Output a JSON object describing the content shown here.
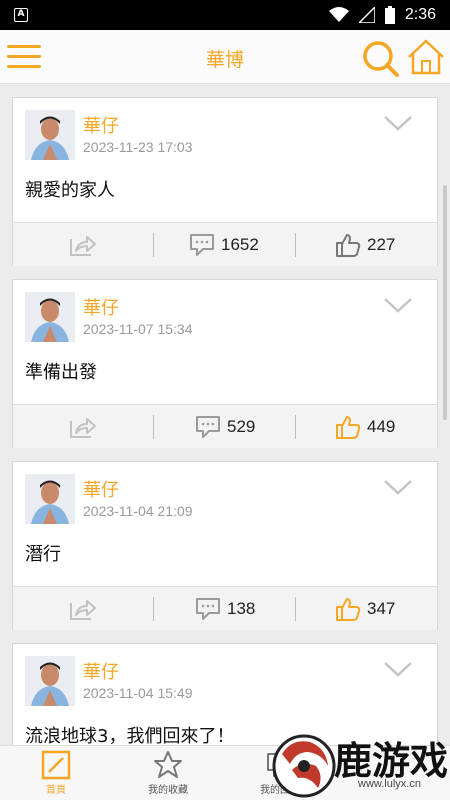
{
  "status_bar": {
    "time": "2:36",
    "app_icon_letter": "A"
  },
  "header": {
    "title": "華博"
  },
  "posts": [
    {
      "author": "華仔",
      "date": "2023-11-23 17:03",
      "content": "親愛的家人",
      "comments": "1652",
      "likes": "227",
      "liked": false
    },
    {
      "author": "華仔",
      "date": "2023-11-07 15:34",
      "content": "準備出發",
      "comments": "529",
      "likes": "449",
      "liked": true
    },
    {
      "author": "華仔",
      "date": "2023-11-04 21:09",
      "content": "潛行",
      "comments": "138",
      "likes": "347",
      "liked": true
    },
    {
      "author": "華仔",
      "date": "2023-11-04 15:49",
      "content": "流浪地球3，我們回來了！",
      "comments": "",
      "likes": "",
      "liked": false
    }
  ],
  "tabs": [
    {
      "label": "首頁",
      "icon": "pencil-icon",
      "active": true
    },
    {
      "label": "我的收藏",
      "icon": "star-icon",
      "active": false
    },
    {
      "label": "我的回應",
      "icon": "reply-icon",
      "active": false
    },
    {
      "label": "",
      "icon": "more-icon",
      "active": false
    }
  ],
  "watermark": {
    "text": "鹿游戏",
    "url": "www.lulyx.cn"
  },
  "colors": {
    "accent": "#f5a623",
    "text": "#111111",
    "meta": "#9a9a9a"
  }
}
